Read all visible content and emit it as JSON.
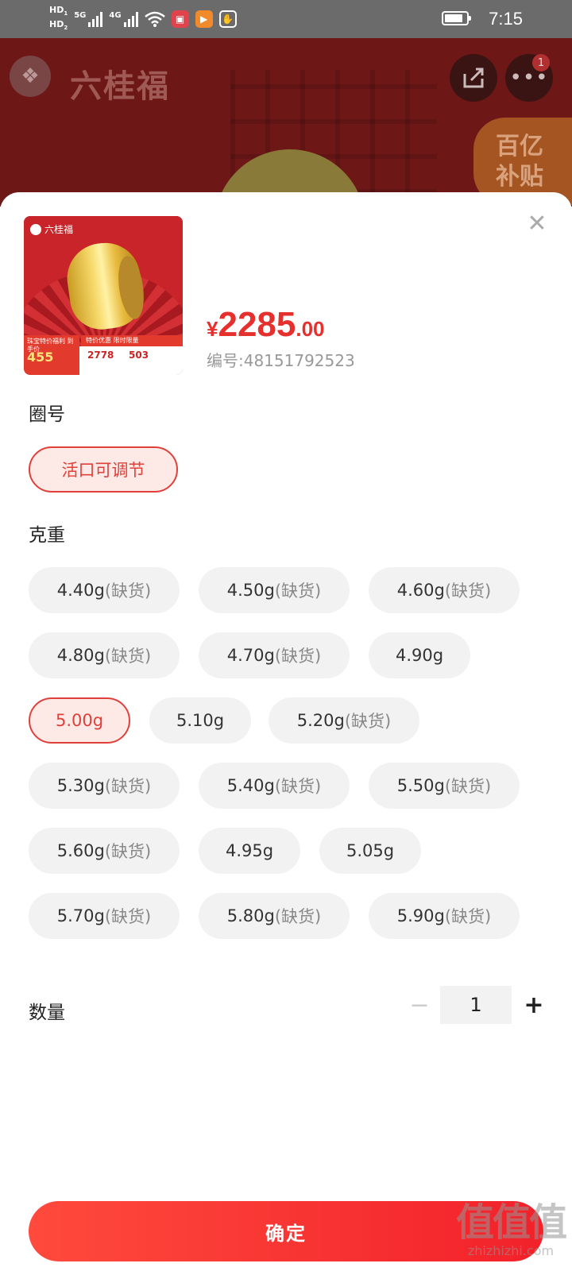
{
  "status_bar": {
    "hd1": "HD",
    "hd1_sub": "1",
    "hd2": "HD",
    "hd2_sub": "2",
    "net1": "5G",
    "net2": "4G",
    "time": "7:15"
  },
  "background": {
    "brand_name": "六桂福",
    "notification_count": "1",
    "subsidy_line1": "百亿",
    "subsidy_line2": "补贴"
  },
  "sheet": {
    "close_icon": "✕",
    "product": {
      "thumb_brand": "六桂福",
      "thumb_price_caption": "珠宝特价福利 到手价",
      "thumb_price": "455",
      "thumb_tag": "特价优惠 限时限量",
      "thumb_num1": "2778",
      "thumb_num2": "503",
      "currency": "¥",
      "price_integer": "2285",
      "price_decimal": ".00",
      "item_number": "编号:48151792523"
    },
    "ring_size": {
      "title": "圈号",
      "options": [
        {
          "label": "活口可调节",
          "suffix": "",
          "selected": true
        }
      ]
    },
    "weight": {
      "title": "克重",
      "options": [
        {
          "label": "4.40g",
          "suffix": "(缺货)",
          "selected": false
        },
        {
          "label": "4.50g",
          "suffix": "(缺货)",
          "selected": false
        },
        {
          "label": "4.60g",
          "suffix": "(缺货)",
          "selected": false
        },
        {
          "label": "4.80g",
          "suffix": "(缺货)",
          "selected": false
        },
        {
          "label": "4.70g",
          "suffix": "(缺货)",
          "selected": false
        },
        {
          "label": "4.90g",
          "suffix": "",
          "selected": false
        },
        {
          "label": "5.00g",
          "suffix": "",
          "selected": true
        },
        {
          "label": "5.10g",
          "suffix": "",
          "selected": false
        },
        {
          "label": "5.20g",
          "suffix": "(缺货)",
          "selected": false
        },
        {
          "label": "5.30g",
          "suffix": "(缺货)",
          "selected": false
        },
        {
          "label": "5.40g",
          "suffix": "(缺货)",
          "selected": false
        },
        {
          "label": "5.50g",
          "suffix": "(缺货)",
          "selected": false
        },
        {
          "label": "5.60g",
          "suffix": "(缺货)",
          "selected": false
        },
        {
          "label": "4.95g",
          "suffix": "",
          "selected": false
        },
        {
          "label": "5.05g",
          "suffix": "",
          "selected": false
        },
        {
          "label": "5.70g",
          "suffix": "(缺货)",
          "selected": false
        },
        {
          "label": "5.80g",
          "suffix": "(缺货)",
          "selected": false
        },
        {
          "label": "5.90g",
          "suffix": "(缺货)",
          "selected": false
        }
      ]
    },
    "quantity": {
      "title": "数量",
      "minus": "−",
      "value": "1",
      "plus": "+"
    },
    "confirm_label": "确定"
  },
  "watermark": {
    "big": "值值值",
    "small": "zhizhizhi.com"
  },
  "colors": {
    "accent": "#e5302d",
    "chip_bg": "#f2f2f2",
    "selected_bg": "#fde9e6"
  }
}
